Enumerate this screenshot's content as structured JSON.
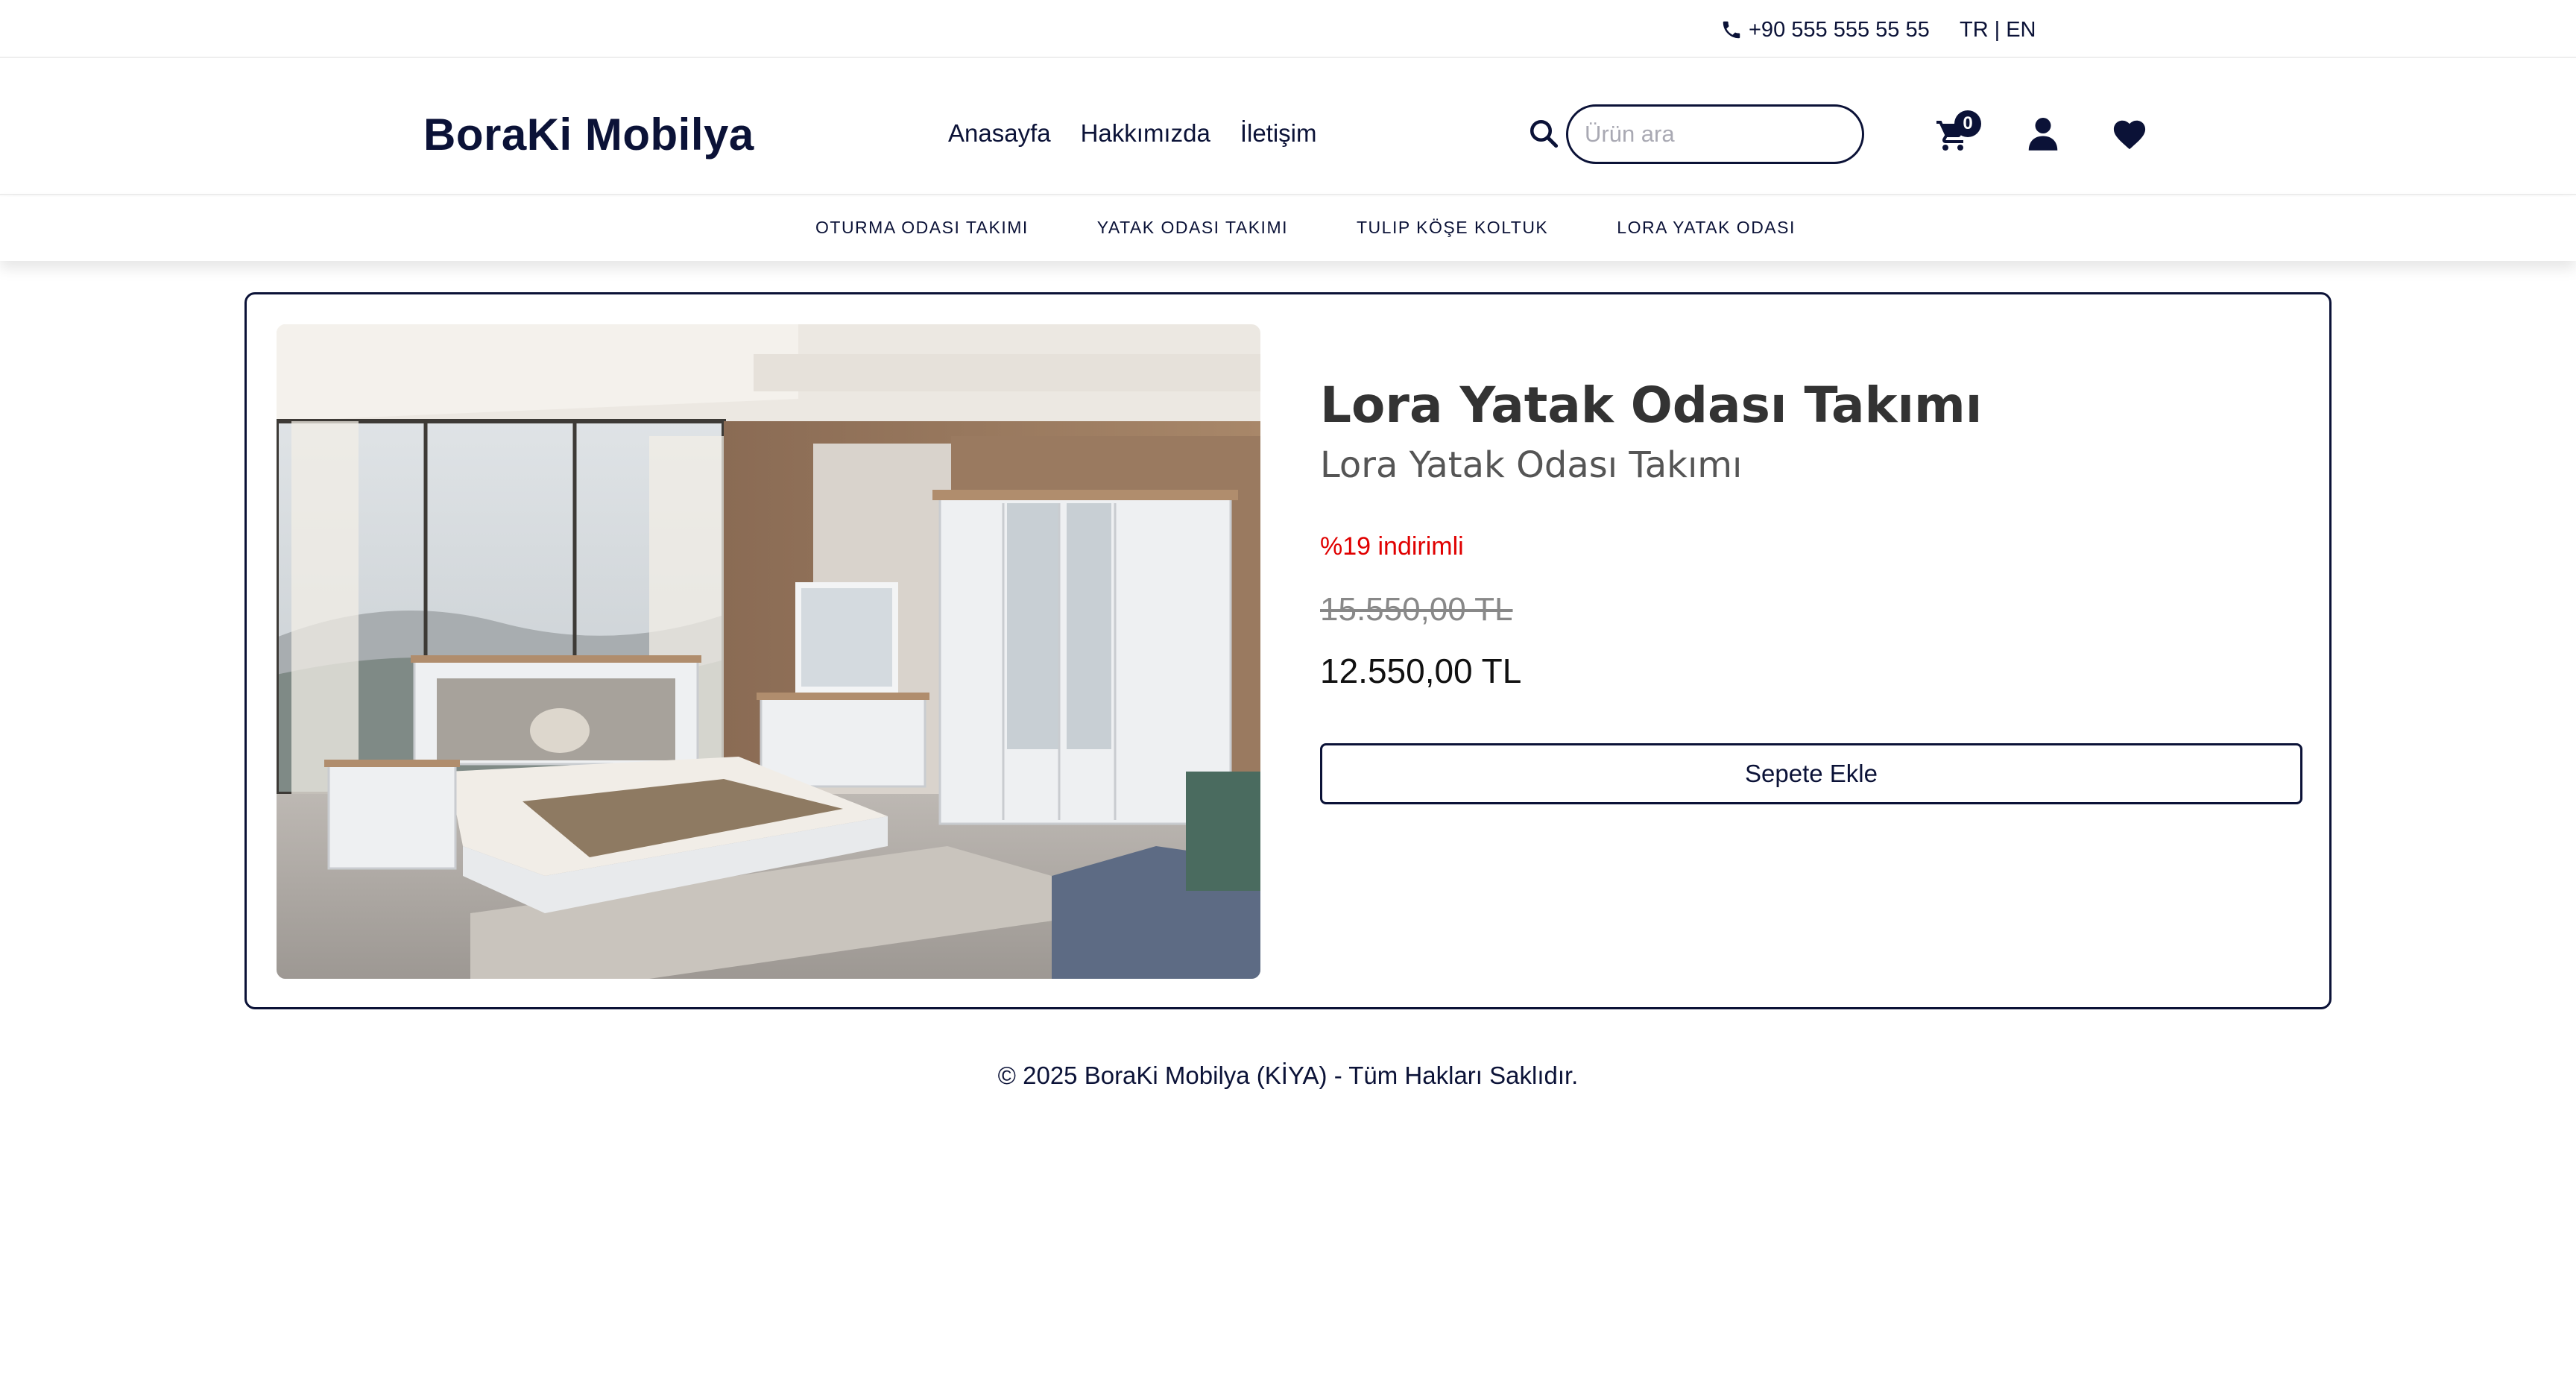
{
  "topbar": {
    "phone": "+90 555 555 55 55",
    "lang_tr": "TR",
    "lang_sep": "|",
    "lang_en": "EN"
  },
  "header": {
    "logo": "BoraKi Mobilya",
    "nav": [
      "Anasayfa",
      "Hakkımızda",
      "İletişim"
    ],
    "search_placeholder": "Ürün ara",
    "cart_count": "0"
  },
  "categories": [
    "OTURMA ODASI TAKIMI",
    "YATAK ODASI TAKIMI",
    "TULIP KÖŞE KOLTUK",
    "LORA YATAK ODASI"
  ],
  "product": {
    "title": "Lora Yatak Odası Takımı",
    "subtitle": "Lora Yatak Odası Takımı",
    "discount": "%19 indirimli",
    "old_price": "15.550,00 TL",
    "price": "12.550,00 TL",
    "add_to_cart": "Sepete Ekle"
  },
  "footer": {
    "copyright": "© 2025 BoraKi Mobilya (KİYA) - Tüm Hakları Saklıdır."
  },
  "icons": {
    "phone": "phone-icon",
    "search": "search-icon",
    "cart": "cart-icon",
    "user": "user-icon",
    "heart": "heart-icon"
  },
  "colors": {
    "brand": "#0b1237",
    "discount": "#e00000",
    "old_price": "#888888"
  }
}
